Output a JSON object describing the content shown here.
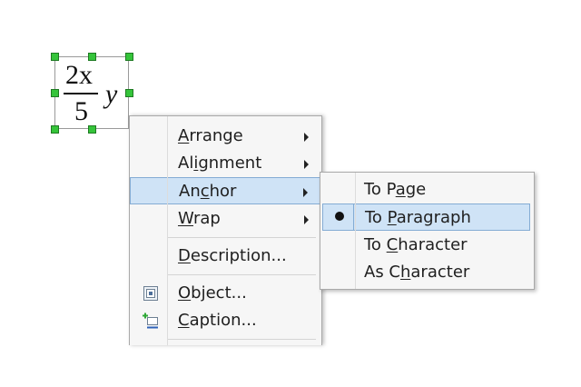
{
  "formula": {
    "numerator": "2x",
    "denominator": "5",
    "variable": "y"
  },
  "context_menu": {
    "items": [
      {
        "label_pre": "",
        "label_key": "A",
        "label_post": "rrange",
        "has_submenu": true
      },
      {
        "label_pre": "Al",
        "label_key": "i",
        "label_post": "gnment",
        "has_submenu": true
      },
      {
        "label_pre": "An",
        "label_key": "c",
        "label_post": "hor",
        "has_submenu": true,
        "highlighted": true
      },
      {
        "label_pre": "",
        "label_key": "W",
        "label_post": "rap",
        "has_submenu": true
      },
      {
        "label_pre": "",
        "label_key": "D",
        "label_post": "escription...",
        "has_submenu": false
      },
      {
        "label_pre": "",
        "label_key": "O",
        "label_post": "bject...",
        "icon": "object-icon"
      },
      {
        "label_pre": "",
        "label_key": "C",
        "label_post": "aption...",
        "icon": "caption-icon"
      }
    ]
  },
  "anchor_submenu": {
    "items": [
      {
        "label_pre": "To P",
        "label_key": "a",
        "label_post": "ge"
      },
      {
        "label_pre": "To ",
        "label_key": "P",
        "label_post": "aragraph",
        "selected": true,
        "highlighted": true
      },
      {
        "label_pre": "To ",
        "label_key": "C",
        "label_post": "haracter"
      },
      {
        "label_pre": "As C",
        "label_key": "h",
        "label_post": "aracter"
      }
    ]
  },
  "colors": {
    "highlight_bg": "#cfe3f6",
    "highlight_border": "#84acd4",
    "handle": "#35c43a",
    "menu_bg": "#f6f6f6"
  }
}
